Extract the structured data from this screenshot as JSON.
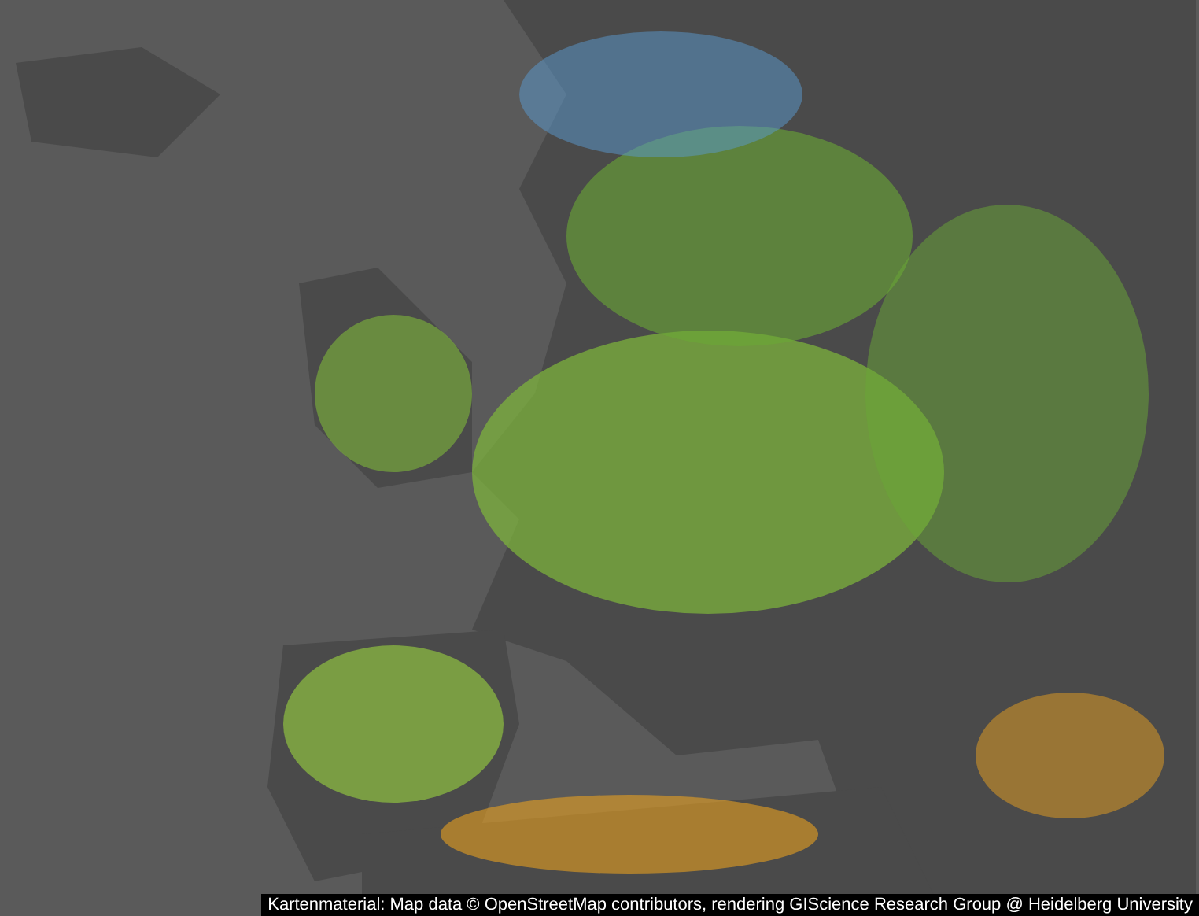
{
  "attribution": "Kartenmaterial: Map data © OpenStreetMap contributors, rendering GIScience Research Group @ Heidelberg University"
}
